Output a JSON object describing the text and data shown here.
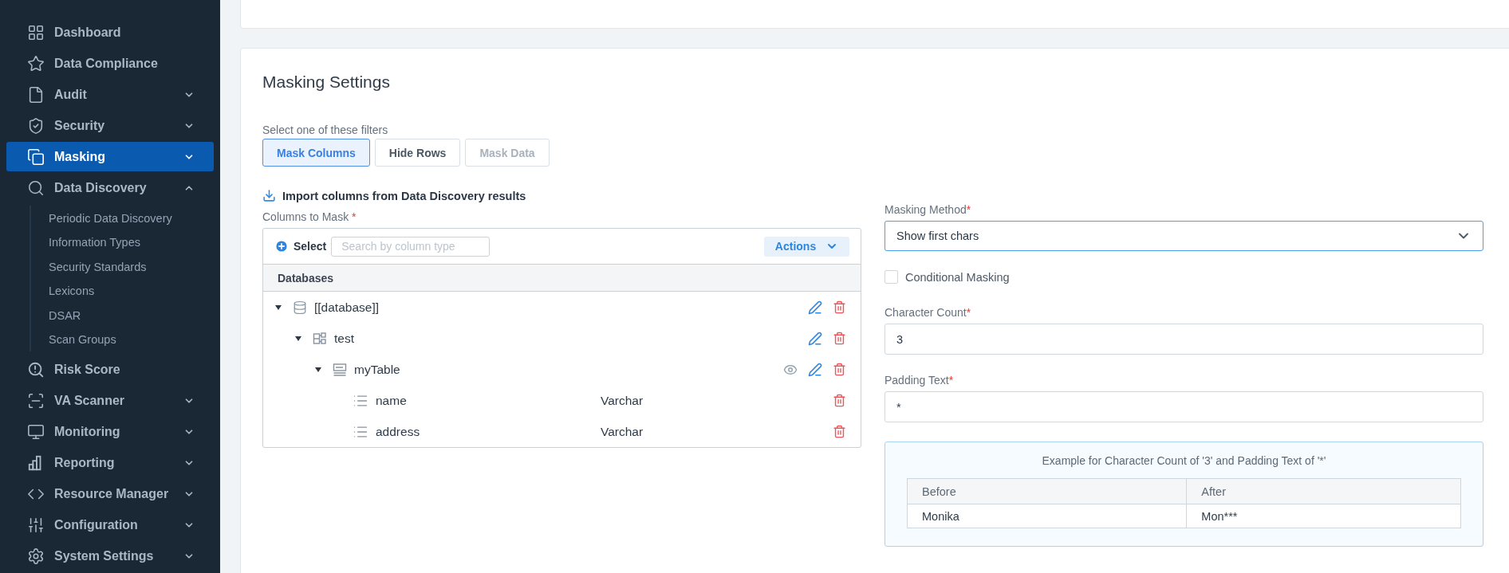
{
  "sidebar": {
    "items": [
      {
        "label": "Dashboard",
        "selected": false
      },
      {
        "label": "Data Compliance",
        "selected": false
      },
      {
        "label": "Audit",
        "selected": false,
        "expanded": false
      },
      {
        "label": "Security",
        "selected": false,
        "expanded": false
      },
      {
        "label": "Masking",
        "selected": true,
        "expanded": false
      },
      {
        "label": "Data Discovery",
        "selected": false,
        "expanded": true,
        "children": [
          {
            "label": "Periodic Data Discovery"
          },
          {
            "label": "Information Types"
          },
          {
            "label": "Security Standards"
          },
          {
            "label": "Lexicons"
          },
          {
            "label": "DSAR"
          },
          {
            "label": "Scan Groups"
          }
        ]
      },
      {
        "label": "Risk Score",
        "selected": false
      },
      {
        "label": "VA Scanner",
        "selected": false,
        "expanded": false
      },
      {
        "label": "Monitoring",
        "selected": false,
        "expanded": false
      },
      {
        "label": "Reporting",
        "selected": false,
        "expanded": false
      },
      {
        "label": "Resource Manager",
        "selected": false,
        "expanded": false
      },
      {
        "label": "Configuration",
        "selected": false,
        "expanded": false
      },
      {
        "label": "System Settings",
        "selected": false,
        "expanded": false
      }
    ]
  },
  "card": {
    "title": "Masking Settings",
    "filters_label": "Select one of these filters",
    "filters": [
      {
        "label": "Mask Columns",
        "selected": true,
        "disabled": false
      },
      {
        "label": "Hide Rows",
        "selected": false,
        "disabled": false
      },
      {
        "label": "Mask Data",
        "selected": false,
        "disabled": true
      }
    ],
    "import_link": "Import columns from Data Discovery results",
    "columns_label": "Columns to Mask",
    "columns_required": "*",
    "tree_toolbar": {
      "select": "Select",
      "search_placeholder": "Search by column type",
      "actions": "Actions"
    },
    "tree_header": "Databases",
    "tree": [
      {
        "kind": "database",
        "label": "[[database]]",
        "expanded": true,
        "children": [
          {
            "kind": "schema",
            "label": "test",
            "expanded": true,
            "children": [
              {
                "kind": "table",
                "label": "myTable",
                "expanded": true,
                "children": [
                  {
                    "kind": "column",
                    "label": "name",
                    "type": "Varchar"
                  },
                  {
                    "kind": "column",
                    "label": "address",
                    "type": "Varchar"
                  }
                ]
              }
            ]
          }
        ]
      }
    ],
    "masking_method": {
      "label": "Masking Method",
      "required": "*",
      "value": "Show first chars"
    },
    "conditional_masking": {
      "label": "Conditional Masking",
      "checked": false
    },
    "character_count": {
      "label": "Character Count",
      "required": "*",
      "value": "3"
    },
    "padding_text": {
      "label": "Padding Text",
      "required": "*",
      "value": "*"
    },
    "example": {
      "caption": "Example for Character Count of '3' and Padding Text of '*'",
      "columns": [
        "Before",
        "After"
      ],
      "rows": [
        [
          "Monika",
          "Mon***"
        ]
      ]
    }
  }
}
